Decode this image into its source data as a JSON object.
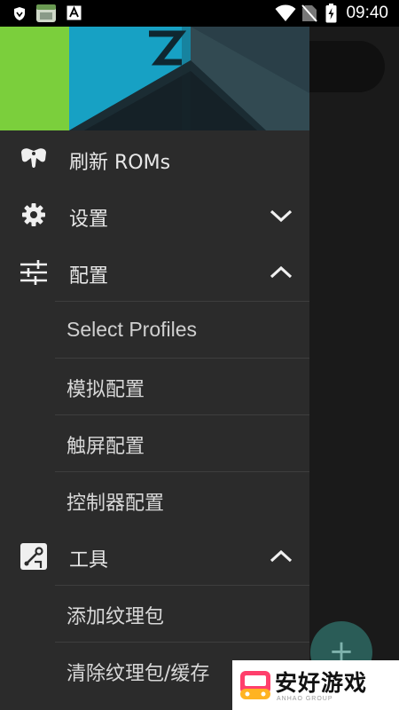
{
  "status_bar": {
    "time": "09:40",
    "icons": [
      "shield-icon",
      "app-icon",
      "font-icon",
      "wifi-icon",
      "no-sim-icon",
      "battery-charging-icon"
    ]
  },
  "drawer": {
    "items": [
      {
        "label": "刷新 ROMs",
        "icon": "gamepad-icon"
      },
      {
        "label": "设置",
        "icon": "gear-icon",
        "expanded": false
      },
      {
        "label": "配置",
        "icon": "sliders-icon",
        "expanded": true,
        "children": [
          "Select Profiles",
          "模拟配置",
          "触屏配置",
          "控制器配置"
        ]
      },
      {
        "label": "工具",
        "icon": "tools-icon",
        "expanded": true,
        "children": [
          "添加纹理包",
          "清除纹理包/缓存"
        ]
      }
    ]
  },
  "fab": {
    "symbol": "+"
  },
  "watermark": {
    "text": "安好游戏",
    "subtext": "ANHAO GROUP"
  },
  "colors": {
    "drawer_bg": "#2b2b2b",
    "header_green": "#7ed13f",
    "header_teal": "#1aa7c7"
  }
}
